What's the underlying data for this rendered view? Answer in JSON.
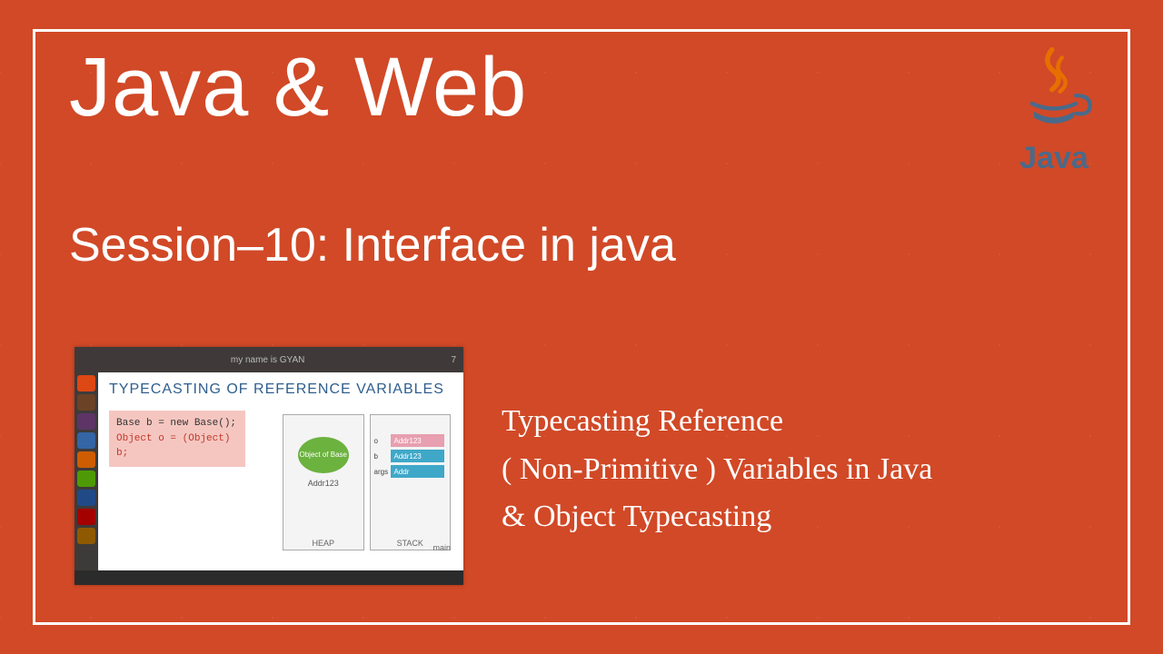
{
  "title": "Java & Web",
  "subtitle": "Session–10: Interface in java",
  "logo_text": "Java",
  "description": {
    "line1": "Typecasting Reference",
    "line2": "( Non-Primitive ) Variables in Java",
    "line3": "& Object Typecasting"
  },
  "thumbnail": {
    "top_center": "my name is GYAN",
    "top_right": "7",
    "heading": "TYPECASTING OF REFERENCE VARIABLES",
    "code_line1": "Base b = new Base();",
    "code_line2": "Object o = (Object) b;",
    "heap_label": "HEAP",
    "stack_label": "STACK",
    "main_label": "main",
    "heap_oval": "Object of Base",
    "heap_addr": "Addr123",
    "stack_rows": {
      "r1_lbl": "o",
      "r1_val": "Addr123",
      "r2_lbl": "b",
      "r2_val": "Addr123",
      "r3_lbl": "args",
      "r3_val": "Addr"
    }
  }
}
